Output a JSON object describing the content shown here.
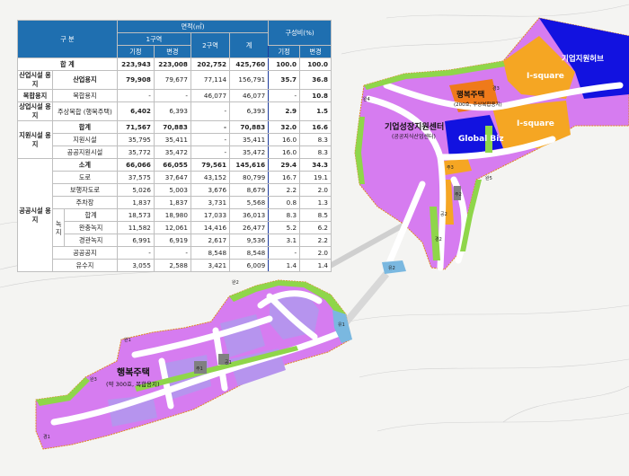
{
  "colors": {
    "residential": "#d67cf0",
    "apartment": "#b694ee",
    "park": "#8fd64a",
    "industrial_support": "#f5a623",
    "business_hub": "#1212e0",
    "housing_mixed": "#ef7a1a",
    "road": "#ffffff",
    "parking": "#808080",
    "water": "#7ab8e0",
    "header": "#1f6fb0"
  },
  "table": {
    "header": {
      "category": "구  분",
      "area": "면적(㎡)",
      "zone1": "1구역",
      "existing": "기정",
      "changed": "변경",
      "zone2": "2구역",
      "sum": "계",
      "ratio": "구성비(%)",
      "ratio_existing": "기정",
      "ratio_changed": "변경"
    },
    "total": {
      "label": "합  계",
      "v": [
        "223,943",
        "223,008",
        "202,752",
        "425,760",
        "100.0",
        "100.0"
      ]
    },
    "industrial": {
      "group": "산업시설 용지",
      "label": "산업용지",
      "v": [
        "79,908",
        "79,677",
        "77,114",
        "156,791",
        "35.7",
        "36.8"
      ]
    },
    "mixed": {
      "group": "복합용지",
      "label": "복합용지",
      "v": [
        "-",
        "-",
        "46,077",
        "46,077",
        "-",
        "10.8"
      ]
    },
    "commercial": {
      "group": "상업시설 용지",
      "label": "주상복합 (행복주택)",
      "v": [
        "6,402",
        "6,393",
        "-",
        "6,393",
        "2.9",
        "1.5"
      ]
    },
    "support": {
      "group": "지원시설 용지",
      "rows": [
        {
          "label": "합계",
          "v": [
            "71,567",
            "70,883",
            "-",
            "70,883",
            "32.0",
            "16.6"
          ]
        },
        {
          "label": "지원시설",
          "v": [
            "35,795",
            "35,411",
            "-",
            "35,411",
            "16.0",
            "8.3"
          ]
        },
        {
          "label": "공공지원시설",
          "v": [
            "35,772",
            "35,472",
            "-",
            "35,472",
            "16.0",
            "8.3"
          ]
        }
      ]
    },
    "public": {
      "group": "공공시설 용지",
      "green_group": "녹 지",
      "rows": [
        {
          "label": "소계",
          "v": [
            "66,066",
            "66,055",
            "79,561",
            "145,616",
            "29.4",
            "34.3"
          ]
        },
        {
          "label": "도로",
          "v": [
            "37,575",
            "37,647",
            "43,152",
            "80,799",
            "16.7",
            "19.1"
          ]
        },
        {
          "label": "보행자도로",
          "v": [
            "5,026",
            "5,003",
            "3,676",
            "8,679",
            "2.2",
            "2.0"
          ]
        },
        {
          "label": "주차장",
          "v": [
            "1,837",
            "1,837",
            "3,731",
            "5,568",
            "0.8",
            "1.3"
          ]
        },
        {
          "label": "합계",
          "v": [
            "18,573",
            "18,980",
            "17,033",
            "36,013",
            "8.3",
            "8.5"
          ]
        },
        {
          "label": "완충녹지",
          "v": [
            "11,582",
            "12,061",
            "14,416",
            "26,477",
            "5.2",
            "6.2"
          ]
        },
        {
          "label": "경관녹지",
          "v": [
            "6,991",
            "6,919",
            "2,617",
            "9,536",
            "3.1",
            "2.2"
          ]
        },
        {
          "label": "공공공지",
          "v": [
            "-",
            "-",
            "8,548",
            "8,548",
            "-",
            "2.0"
          ]
        },
        {
          "label": "유수지",
          "v": [
            "3,055",
            "2,588",
            "3,421",
            "6,009",
            "1.4",
            "1.4"
          ]
        }
      ]
    }
  },
  "labels": {
    "business_hub": "기업지원허브",
    "isquare_top": "I-square",
    "isquare_bottom": "I-square",
    "global_biz": "Global Biz",
    "happy_housing_top": "행복주택",
    "happy_housing_top_sub": "(200호, 주상복합용지)",
    "growth_center": "기업성장지원센터",
    "growth_center_sub": "(공공지식산업센터)",
    "happy_housing_left": "행복주택",
    "happy_housing_left_sub": "(약 300호, 복합용지)"
  },
  "small_tags": [
    "완1",
    "완2",
    "완3",
    "완4",
    "완5",
    "경1",
    "경2",
    "경3",
    "주1",
    "주2",
    "주3",
    "공1",
    "공2",
    "유1",
    "유2"
  ]
}
